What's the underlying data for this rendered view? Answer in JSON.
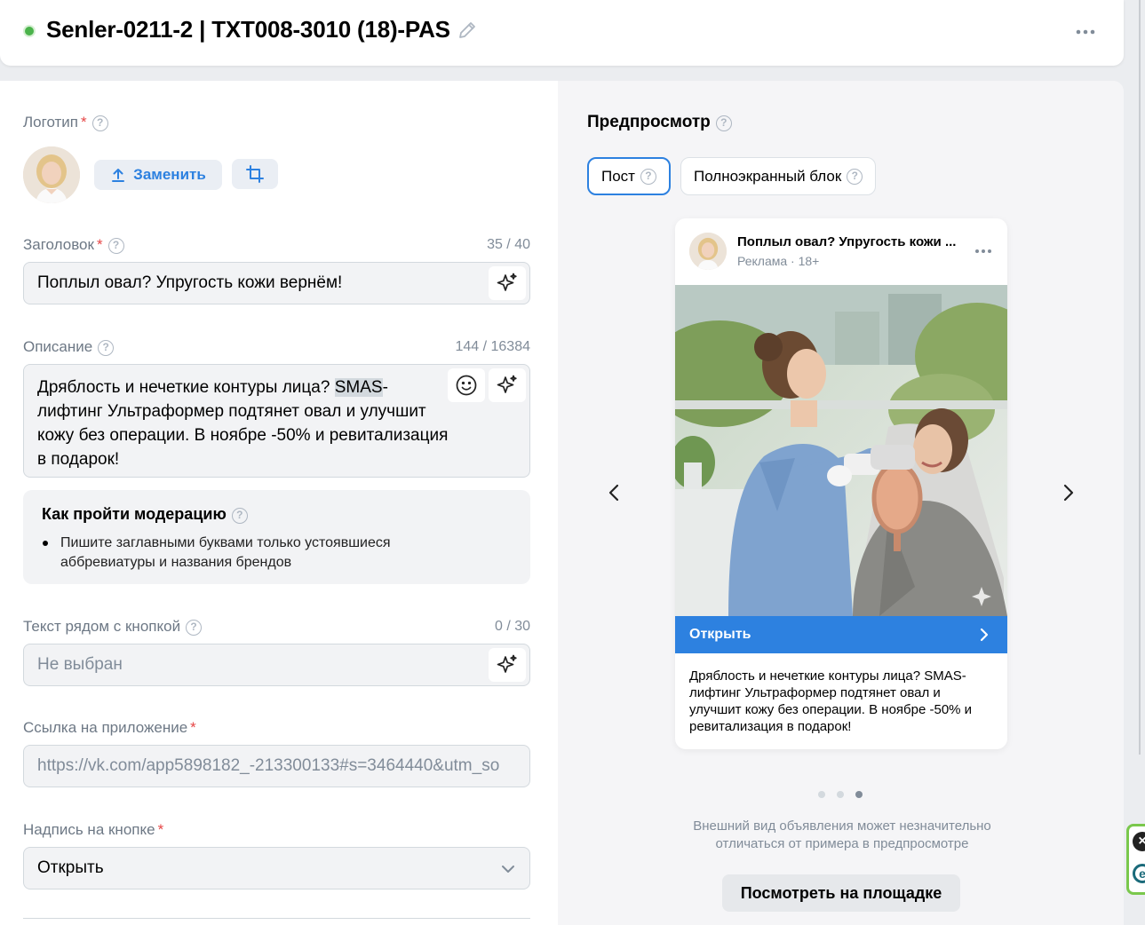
{
  "header": {
    "title": "Senler-0211-2 | TXT008-3010 (18)-PAS",
    "status_color": "#4bb34b"
  },
  "form": {
    "logo": {
      "label": "Логотип",
      "replace_button": "Заменить"
    },
    "headline": {
      "label": "Заголовок",
      "counter": "35 / 40",
      "value": "Поплыл овал? Упругость кожи вернём!"
    },
    "description": {
      "label": "Описание",
      "counter": "144 / 16384",
      "value_before": "Дряблость и нечеткие контуры лица? ",
      "value_highlight": "SMAS",
      "value_after": "-лифтинг Ультраформер подтянет овал и улучшит кожу без операции. В ноябре -50% и ревитализация в подарок!"
    },
    "moderation": {
      "title": "Как пройти модерацию",
      "items": [
        "Пишите заглавными буквами только устоявшиеся аббревиатуры и названия брендов"
      ]
    },
    "button_text": {
      "label": "Текст рядом с кнопкой",
      "counter": "0 / 30",
      "placeholder": "Не выбран"
    },
    "app_link": {
      "label": "Ссылка на приложение",
      "value": "https://vk.com/app5898182_-213300133#s=3464440&utm_so"
    },
    "button_caption": {
      "label": "Надпись на кнопке",
      "value": "Открыть"
    },
    "required_mark": "*"
  },
  "preview": {
    "title": "Предпросмотр",
    "tabs": [
      {
        "label": "Пост",
        "active": true
      },
      {
        "label": "Полноэкранный блок",
        "active": false
      }
    ],
    "card": {
      "title": "Поплыл овал? Упругость кожи ...",
      "subtitle": "Реклама · 18+",
      "cta": "Открыть",
      "description": "Дряблость и нечеткие контуры лица? SMAS-лифтинг Ультраформер подтянет овал и улучшит кожу без операции. В ноябре -50% и ревитализация в подарок!"
    },
    "carousel": {
      "total": 3,
      "active_index": 2
    },
    "disclaimer": "Внешний вид объявления может незначительно отличаться от примера в предпросмотре",
    "view_button": "Посмотреть на площадке"
  },
  "colors": {
    "accent": "#2d81e0",
    "required": "#e64646"
  }
}
